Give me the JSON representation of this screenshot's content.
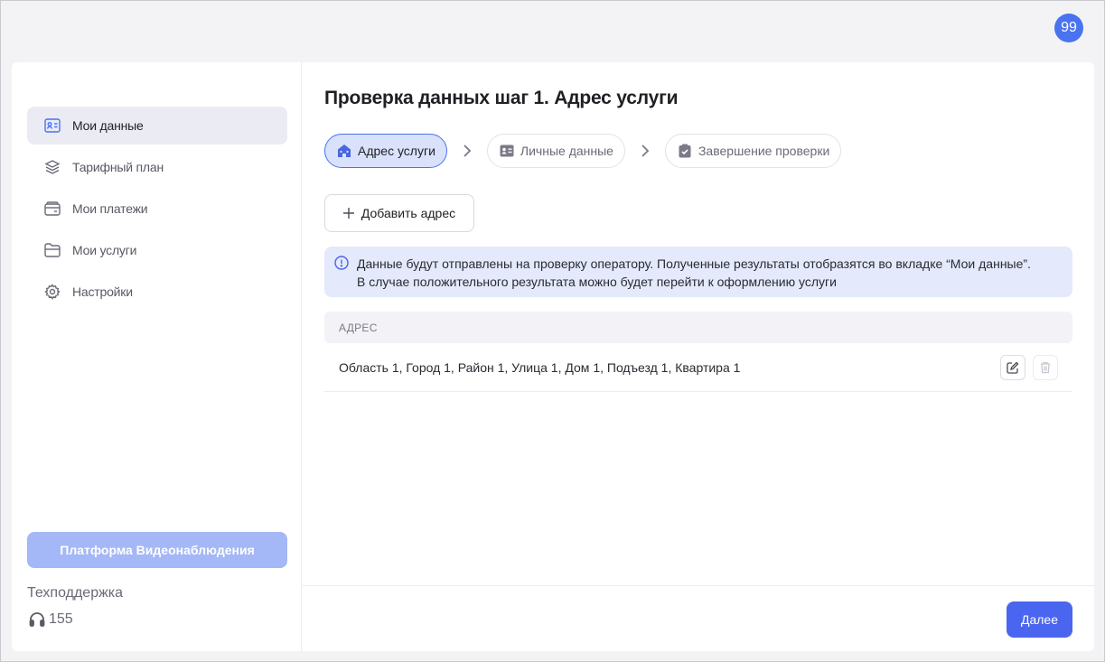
{
  "header": {
    "avatar_initials": "99"
  },
  "sidebar": {
    "items": [
      {
        "label": "Мои данные",
        "icon": "id-card-icon",
        "active": true
      },
      {
        "label": "Тарифный план",
        "icon": "layers-icon",
        "active": false
      },
      {
        "label": "Мои платежи",
        "icon": "wallet-icon",
        "active": false
      },
      {
        "label": "Мои услуги",
        "icon": "folder-icon",
        "active": false
      },
      {
        "label": "Настройки",
        "icon": "gear-icon",
        "active": false
      }
    ],
    "platform_button": "Платформа Видеонаблюдения",
    "support_label": "Техподдержка",
    "support_phone": "155"
  },
  "main": {
    "title": "Проверка данных шаг 1. Адрес услуги",
    "steps": [
      {
        "label": "Адрес услуги",
        "icon": "house-icon",
        "active": true
      },
      {
        "label": "Личные данные",
        "icon": "id-card-icon",
        "active": false
      },
      {
        "label": "Завершение проверки",
        "icon": "clipboard-check-icon",
        "active": false
      }
    ],
    "add_button": "Добавить адрес",
    "info_line1": "Данные будут отправлены на проверку оператору. Полученные результаты отобразятся во вкладке “Мои данные”.",
    "info_line2": "В случае положительного результата можно будет перейти к оформлению услуги",
    "table": {
      "header": "АДРЕС",
      "rows": [
        {
          "address": "Область 1, Город 1, Район 1, Улица 1, Дом 1, Подъезд 1, Квартира 1"
        }
      ]
    },
    "next_button": "Далее"
  },
  "colors": {
    "accent": "#4a73f0",
    "button": "#4a66f0",
    "info_bg": "#e4e9fb",
    "platform_btn": "#a4b7f6"
  }
}
